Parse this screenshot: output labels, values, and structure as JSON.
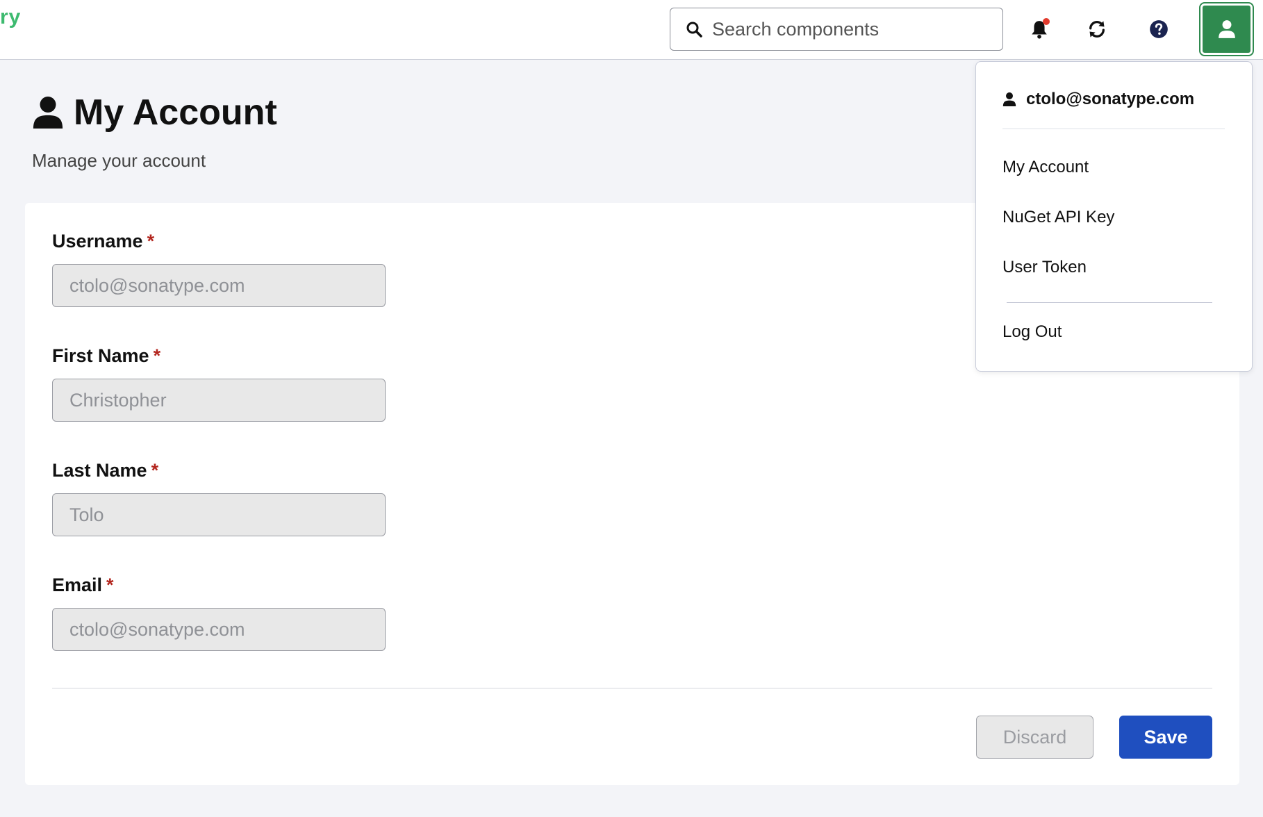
{
  "header": {
    "brand_fragment": "ry",
    "search": {
      "placeholder": "Search components",
      "value": ""
    },
    "icons": [
      "bell-icon",
      "refresh-icon",
      "help-icon",
      "user-icon"
    ],
    "notification_dot": true
  },
  "colors": {
    "brand_green": "#3dba6f",
    "user_button": "#2f8a4f",
    "primary": "#1f4fbf",
    "required": "#b3261e",
    "background": "#f3f4f8"
  },
  "page": {
    "title": "My Account",
    "subtitle": "Manage your account"
  },
  "form": {
    "required_mark": "*",
    "fields": [
      {
        "label": "Username",
        "value": "ctolo@sonatype.com"
      },
      {
        "label": "First Name",
        "value": "Christopher"
      },
      {
        "label": "Last Name",
        "value": "Tolo"
      },
      {
        "label": "Email",
        "value": "ctolo@sonatype.com"
      }
    ],
    "discard_label": "Discard",
    "save_label": "Save"
  },
  "user_menu": {
    "user": "ctolo@sonatype.com",
    "items": [
      "My Account",
      "NuGet API Key",
      "User Token"
    ],
    "logout": "Log Out"
  }
}
